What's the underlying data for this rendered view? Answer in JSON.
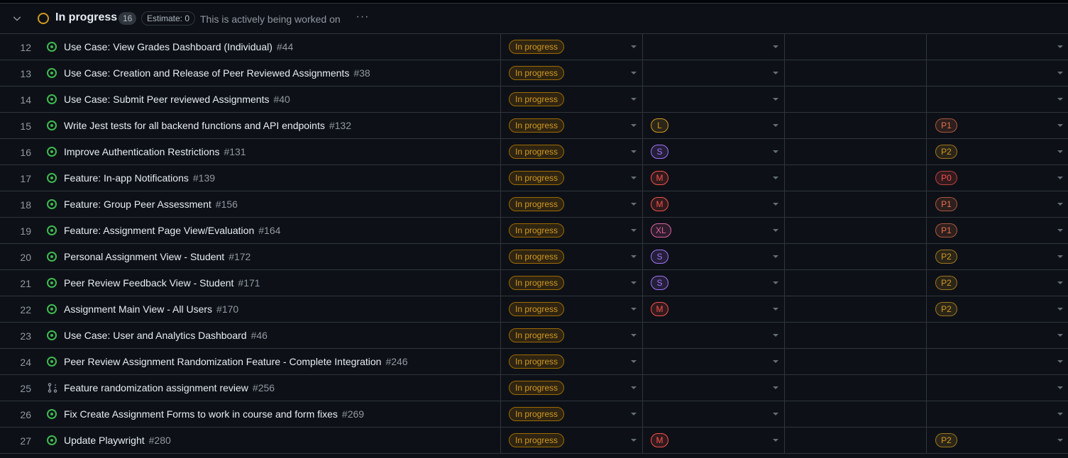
{
  "group": {
    "title": "In progress",
    "count": "16",
    "estimate": "Estimate: 0",
    "description": "This is actively being worked on",
    "more_label": "···",
    "status_color": "#d29922"
  },
  "colors": {
    "size_L": "#d29922",
    "size_S": "#a371f7",
    "size_M": "#f85149",
    "size_XL": "#db61a2",
    "prio_P0": "#f85149",
    "prio_P1": "#e3714b",
    "prio_P2": "#d29922"
  },
  "rows": [
    {
      "num": "12",
      "title": "Use Case: View Grades Dashboard (Individual)",
      "issue": "#44",
      "status": "In progress",
      "size": "",
      "estimate": "",
      "priority": "",
      "icon": "issue-open-icon"
    },
    {
      "num": "13",
      "title": "Use Case: Creation and Release of Peer Reviewed Assignments",
      "issue": "#38",
      "status": "In progress",
      "size": "",
      "estimate": "",
      "priority": "",
      "icon": "issue-open-icon"
    },
    {
      "num": "14",
      "title": "Use Case: Submit Peer reviewed Assignments",
      "issue": "#40",
      "status": "In progress",
      "size": "",
      "estimate": "",
      "priority": "",
      "icon": "issue-open-icon"
    },
    {
      "num": "15",
      "title": "Write Jest tests for all backend functions and API endpoints",
      "issue": "#132",
      "status": "In progress",
      "size": "L",
      "estimate": "",
      "priority": "P1",
      "icon": "issue-open-icon"
    },
    {
      "num": "16",
      "title": "Improve Authentication Restrictions",
      "issue": "#131",
      "status": "In progress",
      "size": "S",
      "estimate": "",
      "priority": "P2",
      "icon": "issue-open-icon"
    },
    {
      "num": "17",
      "title": "Feature: In-app Notifications",
      "issue": "#139",
      "status": "In progress",
      "size": "M",
      "estimate": "",
      "priority": "P0",
      "icon": "issue-open-icon"
    },
    {
      "num": "18",
      "title": "Feature: Group Peer Assessment",
      "issue": "#156",
      "status": "In progress",
      "size": "M",
      "estimate": "",
      "priority": "P1",
      "icon": "issue-open-icon"
    },
    {
      "num": "19",
      "title": "Feature: Assignment Page View/Evaluation",
      "issue": "#164",
      "status": "In progress",
      "size": "XL",
      "estimate": "",
      "priority": "P1",
      "icon": "issue-open-icon"
    },
    {
      "num": "20",
      "title": "Personal Assignment View - Student",
      "issue": "#172",
      "status": "In progress",
      "size": "S",
      "estimate": "",
      "priority": "P2",
      "icon": "issue-open-icon"
    },
    {
      "num": "21",
      "title": "Peer Review Feedback View - Student",
      "issue": "#171",
      "status": "In progress",
      "size": "S",
      "estimate": "",
      "priority": "P2",
      "icon": "issue-open-icon"
    },
    {
      "num": "22",
      "title": "Assignment Main View - All Users",
      "issue": "#170",
      "status": "In progress",
      "size": "M",
      "estimate": "",
      "priority": "P2",
      "icon": "issue-open-icon"
    },
    {
      "num": "23",
      "title": "Use Case: User and Analytics Dashboard",
      "issue": "#46",
      "status": "In progress",
      "size": "",
      "estimate": "",
      "priority": "",
      "icon": "issue-open-icon"
    },
    {
      "num": "24",
      "title": "Peer Review Assignment Randomization Feature - Complete Integration",
      "issue": "#246",
      "status": "In progress",
      "size": "",
      "estimate": "",
      "priority": "",
      "icon": "issue-open-icon"
    },
    {
      "num": "25",
      "title": "Feature randomization assignment review",
      "issue": "#256",
      "status": "In progress",
      "size": "",
      "estimate": "",
      "priority": "",
      "icon": "pull-request-draft-icon"
    },
    {
      "num": "26",
      "title": "Fix Create Assignment Forms to work in course and form fixes",
      "issue": "#269",
      "status": "In progress",
      "size": "",
      "estimate": "",
      "priority": "",
      "icon": "issue-open-icon"
    },
    {
      "num": "27",
      "title": "Update Playwright",
      "issue": "#280",
      "status": "In progress",
      "size": "M",
      "estimate": "",
      "priority": "P2",
      "icon": "issue-open-icon"
    }
  ]
}
